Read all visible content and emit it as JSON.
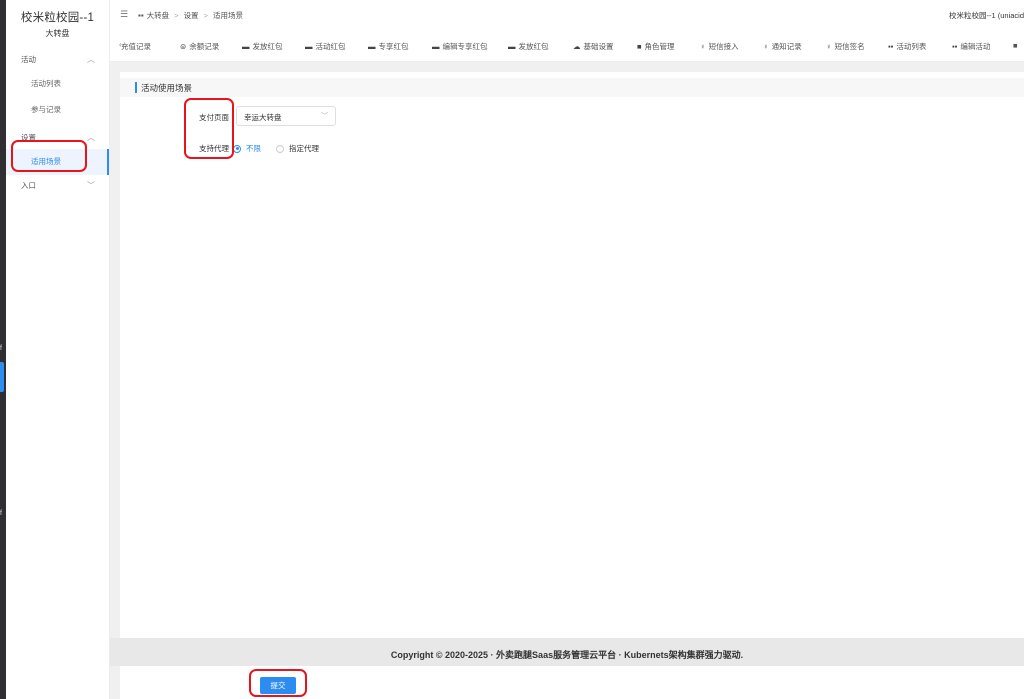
{
  "sidebar": {
    "brand_title": "校米粒校园--1",
    "brand_sub": "大转盘",
    "groups": [
      {
        "label": "活动",
        "items": [
          "活动列表",
          "参与记录"
        ]
      },
      {
        "label": "设置",
        "items": [
          "适用场景"
        ]
      },
      {
        "label": "入口",
        "items": []
      }
    ]
  },
  "topbar": {
    "breadcrumb": [
      "大转盘",
      "设置",
      "适用场景"
    ],
    "user": "校米粒校园--1 (uniacid"
  },
  "tabs": [
    "充值记录",
    "余额记录",
    "发放红包",
    "活动红包",
    "专享红包",
    "编辑专享红包",
    "发放红包",
    "基础设置",
    "角色管理",
    "短信接入",
    "通知记录",
    "短信签名",
    "活动列表",
    "编辑活动",
    "■"
  ],
  "section_title": "活动使用场景",
  "form": {
    "pay_page_label": "支付页面",
    "pay_page_value": "幸运大转盘",
    "agent_label": "支持代理",
    "agent_options": [
      {
        "label": "不限",
        "checked": true
      },
      {
        "label": "指定代理",
        "checked": false
      }
    ]
  },
  "footer": {
    "copyright": "Copyright © 2020-2025 · 外卖跑腿Saas服务管理云平台 · Kubernets架构集群强力驱动."
  },
  "submit_label": "提交",
  "colors": {
    "accent": "#2d8cf0",
    "annotation": "#e8141c"
  }
}
